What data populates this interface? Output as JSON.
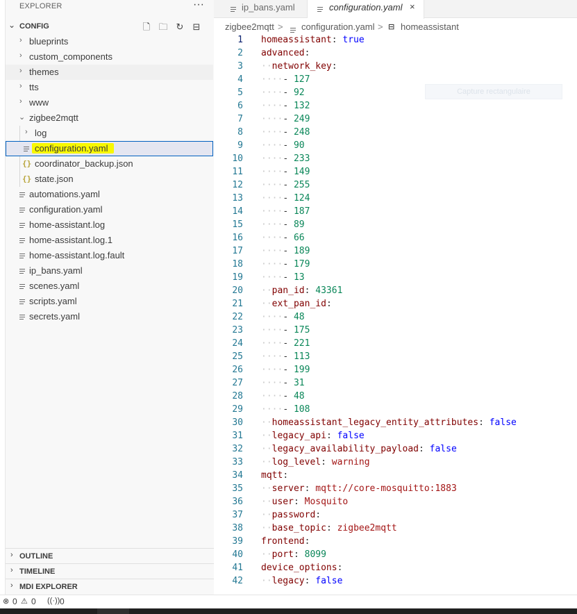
{
  "sidebar": {
    "header": "EXPLORER",
    "more_label": "···",
    "section_title": "CONFIG",
    "section_actions": [
      {
        "name": "new-file-icon",
        "glyph": "🗋"
      },
      {
        "name": "new-folder-icon",
        "glyph": "🗀"
      },
      {
        "name": "refresh-icon",
        "glyph": "↻"
      },
      {
        "name": "collapse-all-icon",
        "glyph": "⊟"
      }
    ],
    "tree": [
      {
        "label": "blueprints",
        "type": "folder",
        "expanded": false
      },
      {
        "label": "custom_components",
        "type": "folder",
        "expanded": false
      },
      {
        "label": "themes",
        "type": "folder",
        "expanded": false
      },
      {
        "label": "tts",
        "type": "folder",
        "expanded": false
      },
      {
        "label": "www",
        "type": "folder",
        "expanded": false
      },
      {
        "label": "zigbee2mqtt",
        "type": "folder",
        "expanded": true
      },
      {
        "label": "log",
        "type": "folder",
        "expanded": false
      },
      {
        "label": "configuration.yaml",
        "type": "yaml",
        "selected": true
      },
      {
        "label": "coordinator_backup.json",
        "type": "json"
      },
      {
        "label": "state.json",
        "type": "json"
      },
      {
        "label": "automations.yaml",
        "type": "yaml"
      },
      {
        "label": "configuration.yaml",
        "type": "yaml"
      },
      {
        "label": "home-assistant.log",
        "type": "log"
      },
      {
        "label": "home-assistant.log.1",
        "type": "log"
      },
      {
        "label": "home-assistant.log.fault",
        "type": "log"
      },
      {
        "label": "ip_bans.yaml",
        "type": "yaml"
      },
      {
        "label": "scenes.yaml",
        "type": "yaml"
      },
      {
        "label": "scripts.yaml",
        "type": "yaml"
      },
      {
        "label": "secrets.yaml",
        "type": "yaml"
      }
    ],
    "panels": [
      "OUTLINE",
      "TIMELINE",
      "MDI EXPLORER"
    ]
  },
  "tabs": [
    {
      "label": "ip_bans.yaml",
      "active": false
    },
    {
      "label": "configuration.yaml",
      "active": true,
      "close": "×"
    }
  ],
  "breadcrumb": {
    "folder": "zigbee2mqtt",
    "sep": ">",
    "file": "configuration.yaml",
    "symbol": "homeassistant"
  },
  "ghost_label": "Capture rectangulaire",
  "code_lines": [
    "1",
    "2",
    "3",
    "4",
    "5",
    "6",
    "7",
    "8",
    "9",
    "10",
    "11",
    "12",
    "13",
    "14",
    "15",
    "16",
    "17",
    "18",
    "19",
    "20",
    "21",
    "22",
    "23",
    "24",
    "25",
    "26",
    "27",
    "28",
    "29",
    "30",
    "31",
    "32",
    "33",
    "34",
    "35",
    "36",
    "37",
    "38",
    "39",
    "40",
    "41",
    "42"
  ],
  "code": {
    "l1": {
      "key": "homeassistant",
      "val": "true"
    },
    "l2": {
      "key": "advanced"
    },
    "l3": {
      "key": "network_key"
    },
    "network_key": [
      "127",
      "92",
      "132",
      "249",
      "248",
      "90",
      "233",
      "149",
      "255",
      "124",
      "187",
      "89",
      "66",
      "189",
      "179",
      "13"
    ],
    "pan_id": {
      "key": "pan_id",
      "val": "43361"
    },
    "ext_pan_id_key": "ext_pan_id",
    "ext_pan_id": [
      "48",
      "175",
      "221",
      "113",
      "199",
      "31",
      "48",
      "108"
    ],
    "l30": {
      "key": "homeassistant_legacy_entity_attributes",
      "val": "false"
    },
    "l31": {
      "key": "legacy_api",
      "val": "false"
    },
    "l32": {
      "key": "legacy_availability_payload",
      "val": "false"
    },
    "l33": {
      "key": "log_level",
      "val": "warning"
    },
    "l34": {
      "key": "mqtt"
    },
    "l35": {
      "key": "server",
      "val": "mqtt://core-mosquitto:1883"
    },
    "l36": {
      "key": "user",
      "val": "Mosquito"
    },
    "l37": {
      "key": "password",
      "val": ""
    },
    "l38": {
      "key": "base_topic",
      "val": "zigbee2mqtt"
    },
    "l39": {
      "key": "frontend"
    },
    "l40": {
      "key": "port",
      "val": "8099"
    },
    "l41": {
      "key": "device_options"
    },
    "l42": {
      "key": "legacy",
      "val": "false"
    }
  },
  "statusbar": {
    "errors": "0",
    "warnings": "0",
    "ports": "0"
  }
}
